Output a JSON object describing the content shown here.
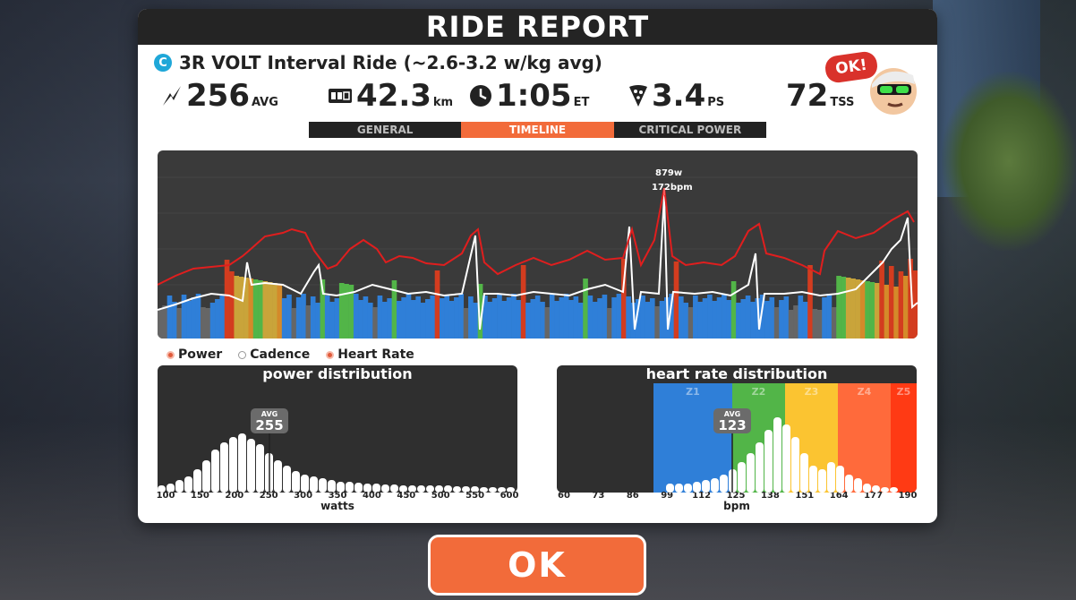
{
  "report": {
    "title": "RIDE REPORT",
    "ride_badge": "C",
    "ride_name": "3R VOLT Interval Ride (~2.6-3.2 w/kg avg)"
  },
  "stats": {
    "power": {
      "value": "256",
      "unit": "AVG",
      "icon": "lightning-icon"
    },
    "distance": {
      "value": "42.3",
      "unit": "km",
      "icon": "odometer-icon"
    },
    "time": {
      "value": "1:05",
      "unit": "ET",
      "icon": "clock-icon"
    },
    "pizza": {
      "value": "3.4",
      "unit": "PS",
      "icon": "pizza-icon"
    },
    "tss": {
      "value": "72",
      "unit": "TSS"
    }
  },
  "avatar": {
    "bubble": "OK!"
  },
  "tabs": [
    {
      "label": "GENERAL",
      "active": false
    },
    {
      "label": "TIMELINE",
      "active": true
    },
    {
      "label": "CRITICAL POWER",
      "active": false
    }
  ],
  "timeline": {
    "peak_power": "879w",
    "peak_hr": "172bpm"
  },
  "legend": [
    {
      "label": "Power",
      "color": "#e05a3a"
    },
    {
      "label": "Cadence",
      "color": "#ffffff"
    },
    {
      "label": "Heart Rate",
      "color": "#e05a3a"
    }
  ],
  "power_dist": {
    "title": "power distribution",
    "avg_label": "AVG",
    "avg_value": "255",
    "xlabel": "watts",
    "ticks": [
      "100",
      "150",
      "200",
      "250",
      "300",
      "350",
      "400",
      "450",
      "500",
      "550",
      "600"
    ]
  },
  "hr_dist": {
    "title": "heart rate distribution",
    "avg_label": "AVG",
    "avg_value": "123",
    "xlabel": "bpm",
    "ticks": [
      "60",
      "73",
      "86",
      "99",
      "112",
      "125",
      "138",
      "151",
      "164",
      "177",
      "190"
    ],
    "zones": [
      {
        "label": "Z1",
        "color": "#2f7fd8"
      },
      {
        "label": "Z2",
        "color": "#52b548"
      },
      {
        "label": "Z3",
        "color": "#fbc431"
      },
      {
        "label": "Z4",
        "color": "#ff6a3b"
      },
      {
        "label": "Z5",
        "color": "#ff3a14"
      }
    ]
  },
  "ok_button": "OK"
}
